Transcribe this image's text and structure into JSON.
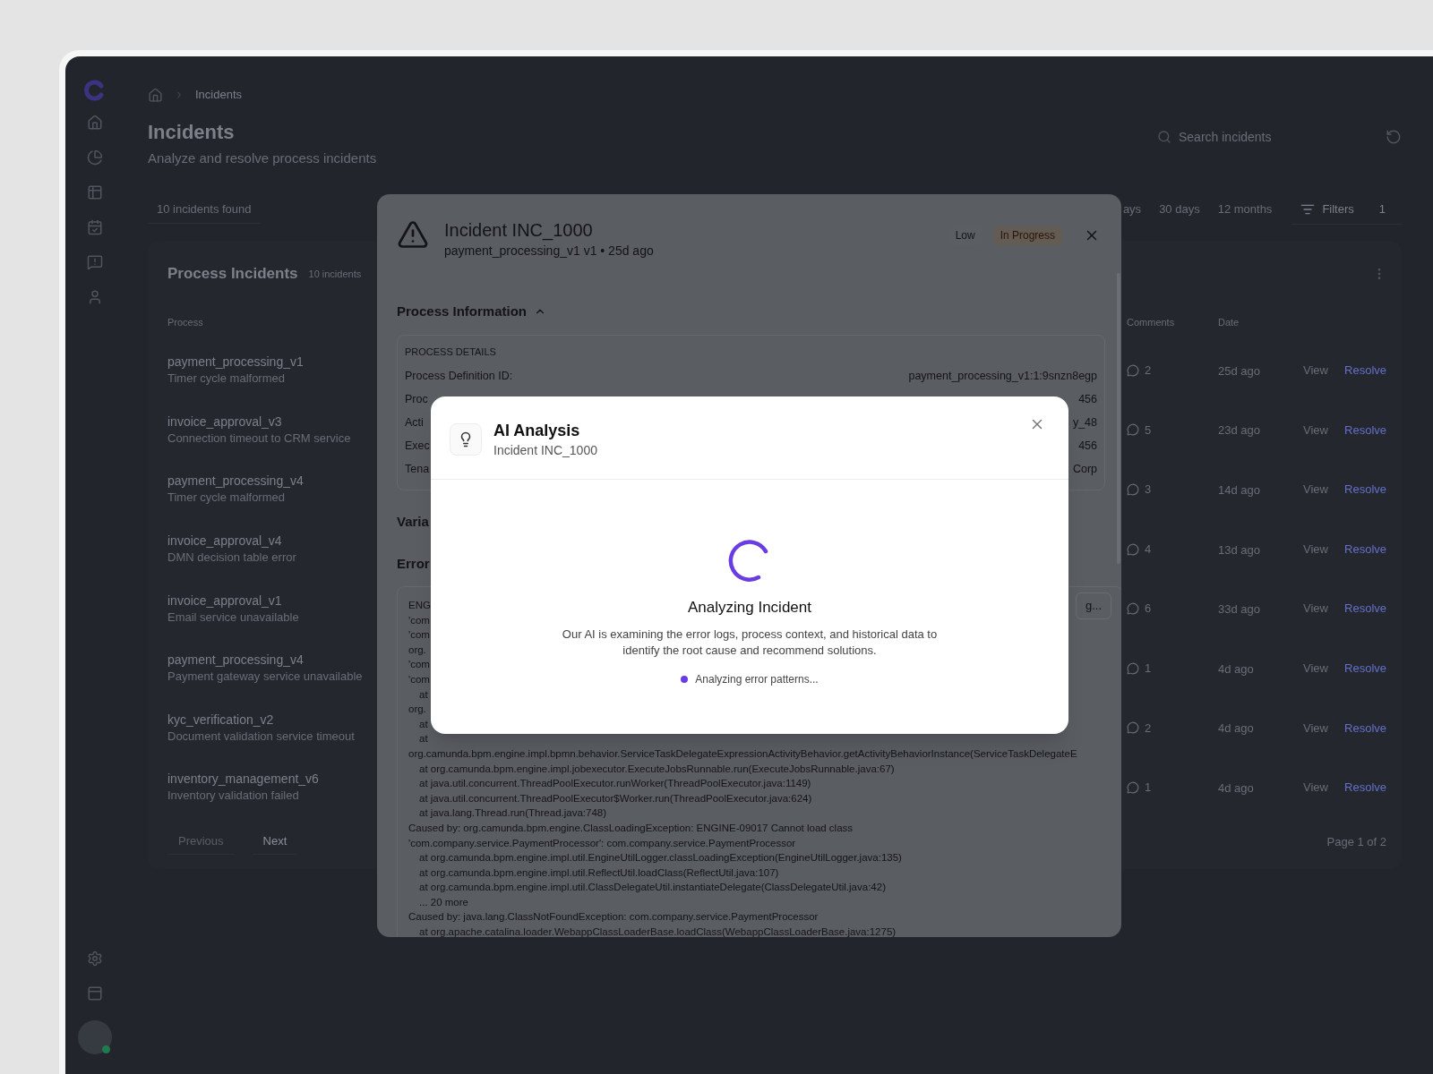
{
  "sidebar": {
    "user": {
      "online": true
    }
  },
  "breadcrumb": {
    "current": "Incidents"
  },
  "page": {
    "title": "Incidents",
    "subtitle": "Analyze and resolve process incidents"
  },
  "search": {
    "placeholder": "Search incidents"
  },
  "toolbar": {
    "results": "10 incidents found",
    "time_ranges": [
      "ays",
      "30 days",
      "12 months"
    ],
    "filters": {
      "label": "Filters",
      "count": "1"
    }
  },
  "table": {
    "title": "Process Incidents",
    "count": "10 incidents",
    "columns": [
      "Process",
      "Comments",
      "Date"
    ],
    "rows": [
      {
        "process": "payment_processing_v1",
        "error": "Timer cycle malformed",
        "comments": "2",
        "date": "25d ago",
        "view": "View",
        "resolve": "Resolve"
      },
      {
        "process": "invoice_approval_v3",
        "error": "Connection timeout to CRM service",
        "comments": "5",
        "date": "23d ago",
        "view": "View",
        "resolve": "Resolve"
      },
      {
        "process": "payment_processing_v4",
        "error": "Timer cycle malformed",
        "comments": "3",
        "date": "14d ago",
        "view": "View",
        "resolve": "Resolve"
      },
      {
        "process": "invoice_approval_v4",
        "error": "DMN decision table error",
        "comments": "4",
        "date": "13d ago",
        "view": "View",
        "resolve": "Resolve"
      },
      {
        "process": "invoice_approval_v1",
        "error": "Email service unavailable",
        "comments": "6",
        "date": "33d ago",
        "view": "View",
        "resolve": "Resolve"
      },
      {
        "process": "payment_processing_v4",
        "error": "Payment gateway service unavailable",
        "comments": "1",
        "date": "4d ago",
        "view": "View",
        "resolve": "Resolve"
      },
      {
        "process": "kyc_verification_v2",
        "error": "Document validation service timeout",
        "comments": "2",
        "date": "4d ago",
        "view": "View",
        "resolve": "Resolve"
      },
      {
        "process": "inventory_management_v6",
        "error": "Inventory validation failed",
        "comments": "1",
        "date": "4d ago",
        "view": "View",
        "resolve": "Resolve"
      }
    ]
  },
  "pagination": {
    "previous": {
      "label": "Previous",
      "disabled": true
    },
    "next": {
      "label": "Next",
      "disabled": false
    },
    "page": "Page 1 of 2"
  },
  "incident_dialog": {
    "title": "Incident INC_1000",
    "subtitle": "payment_processing_v1 v1 • 25d ago",
    "badges": [
      {
        "kind": "priority",
        "label": "Low"
      },
      {
        "kind": "status",
        "label": "In Progress"
      }
    ],
    "process_information": {
      "title": "Process Information",
      "expanded": true,
      "group": "PROCESS DETAILS",
      "fields": [
        {
          "label": "Process Definition ID:",
          "value": "payment_processing_v1:1:9snzn8egp"
        },
        {
          "label": "Proc",
          "value": "456"
        },
        {
          "label": "Acti",
          "value": "y_48"
        },
        {
          "label": "Exec",
          "value": "456"
        },
        {
          "label": "Tena",
          "value": "Corp"
        }
      ]
    },
    "variables_heading": "Varia",
    "error_heading": "Error",
    "log_button": "g...",
    "log_lines": [
      {
        "kind": "head",
        "text": "ENG"
      },
      {
        "kind": "head",
        "text": "'com"
      },
      {
        "kind": "head",
        "text": "'com"
      },
      {
        "kind": "head",
        "text": "org."
      },
      {
        "kind": "head",
        "text": "'com"
      },
      {
        "kind": "head",
        "text": "'com"
      },
      {
        "kind": "frame",
        "text": "at"
      },
      {
        "kind": "head",
        "text": "org."
      },
      {
        "kind": "frame",
        "text": "at"
      },
      {
        "kind": "frame",
        "text": "at"
      },
      {
        "kind": "head",
        "text": "org.camunda.bpm.engine.impl.bpmn.behavior.ServiceTaskDelegateExpressionActivityBehavior.getActivityBehaviorInstance(ServiceTaskDelegateE"
      },
      {
        "kind": "frame",
        "text": "at org.camunda.bpm.engine.impl.jobexecutor.ExecuteJobsRunnable.run(ExecuteJobsRunnable.java:67)"
      },
      {
        "kind": "frame",
        "text": "at java.util.concurrent.ThreadPoolExecutor.runWorker(ThreadPoolExecutor.java:1149)"
      },
      {
        "kind": "frame",
        "text": "at java.util.concurrent.ThreadPoolExecutor$Worker.run(ThreadPoolExecutor.java:624)"
      },
      {
        "kind": "frame",
        "text": "at java.lang.Thread.run(Thread.java:748)"
      },
      {
        "kind": "head",
        "text": "Caused by: org.camunda.bpm.engine.ClassLoadingException: ENGINE-09017 Cannot load class"
      },
      {
        "kind": "head",
        "text": "'com.company.service.PaymentProcessor': com.company.service.PaymentProcessor"
      },
      {
        "kind": "frame",
        "text": "at org.camunda.bpm.engine.impl.util.EngineUtilLogger.classLoadingException(EngineUtilLogger.java:135)"
      },
      {
        "kind": "frame",
        "text": "at org.camunda.bpm.engine.impl.util.ReflectUtil.loadClass(ReflectUtil.java:107)"
      },
      {
        "kind": "frame",
        "text": "at org.camunda.bpm.engine.impl.util.ClassDelegateUtil.instantiateDelegate(ClassDelegateUtil.java:42)"
      },
      {
        "kind": "frame",
        "text": "... 20 more"
      },
      {
        "kind": "head",
        "text": "Caused by: java.lang.ClassNotFoundException: com.company.service.PaymentProcessor"
      },
      {
        "kind": "frame",
        "text": "at org.apache.catalina.loader.WebappClassLoaderBase.loadClass(WebappClassLoaderBase.java:1275)"
      }
    ]
  },
  "ai_dialog": {
    "title": "AI Analysis",
    "subtitle": "Incident INC_1000",
    "status_title": "Analyzing Incident",
    "description": "Our AI is examining the error logs, process context, and historical data to identify the root cause and recommend solutions.",
    "step": "Analyzing error patterns..."
  }
}
